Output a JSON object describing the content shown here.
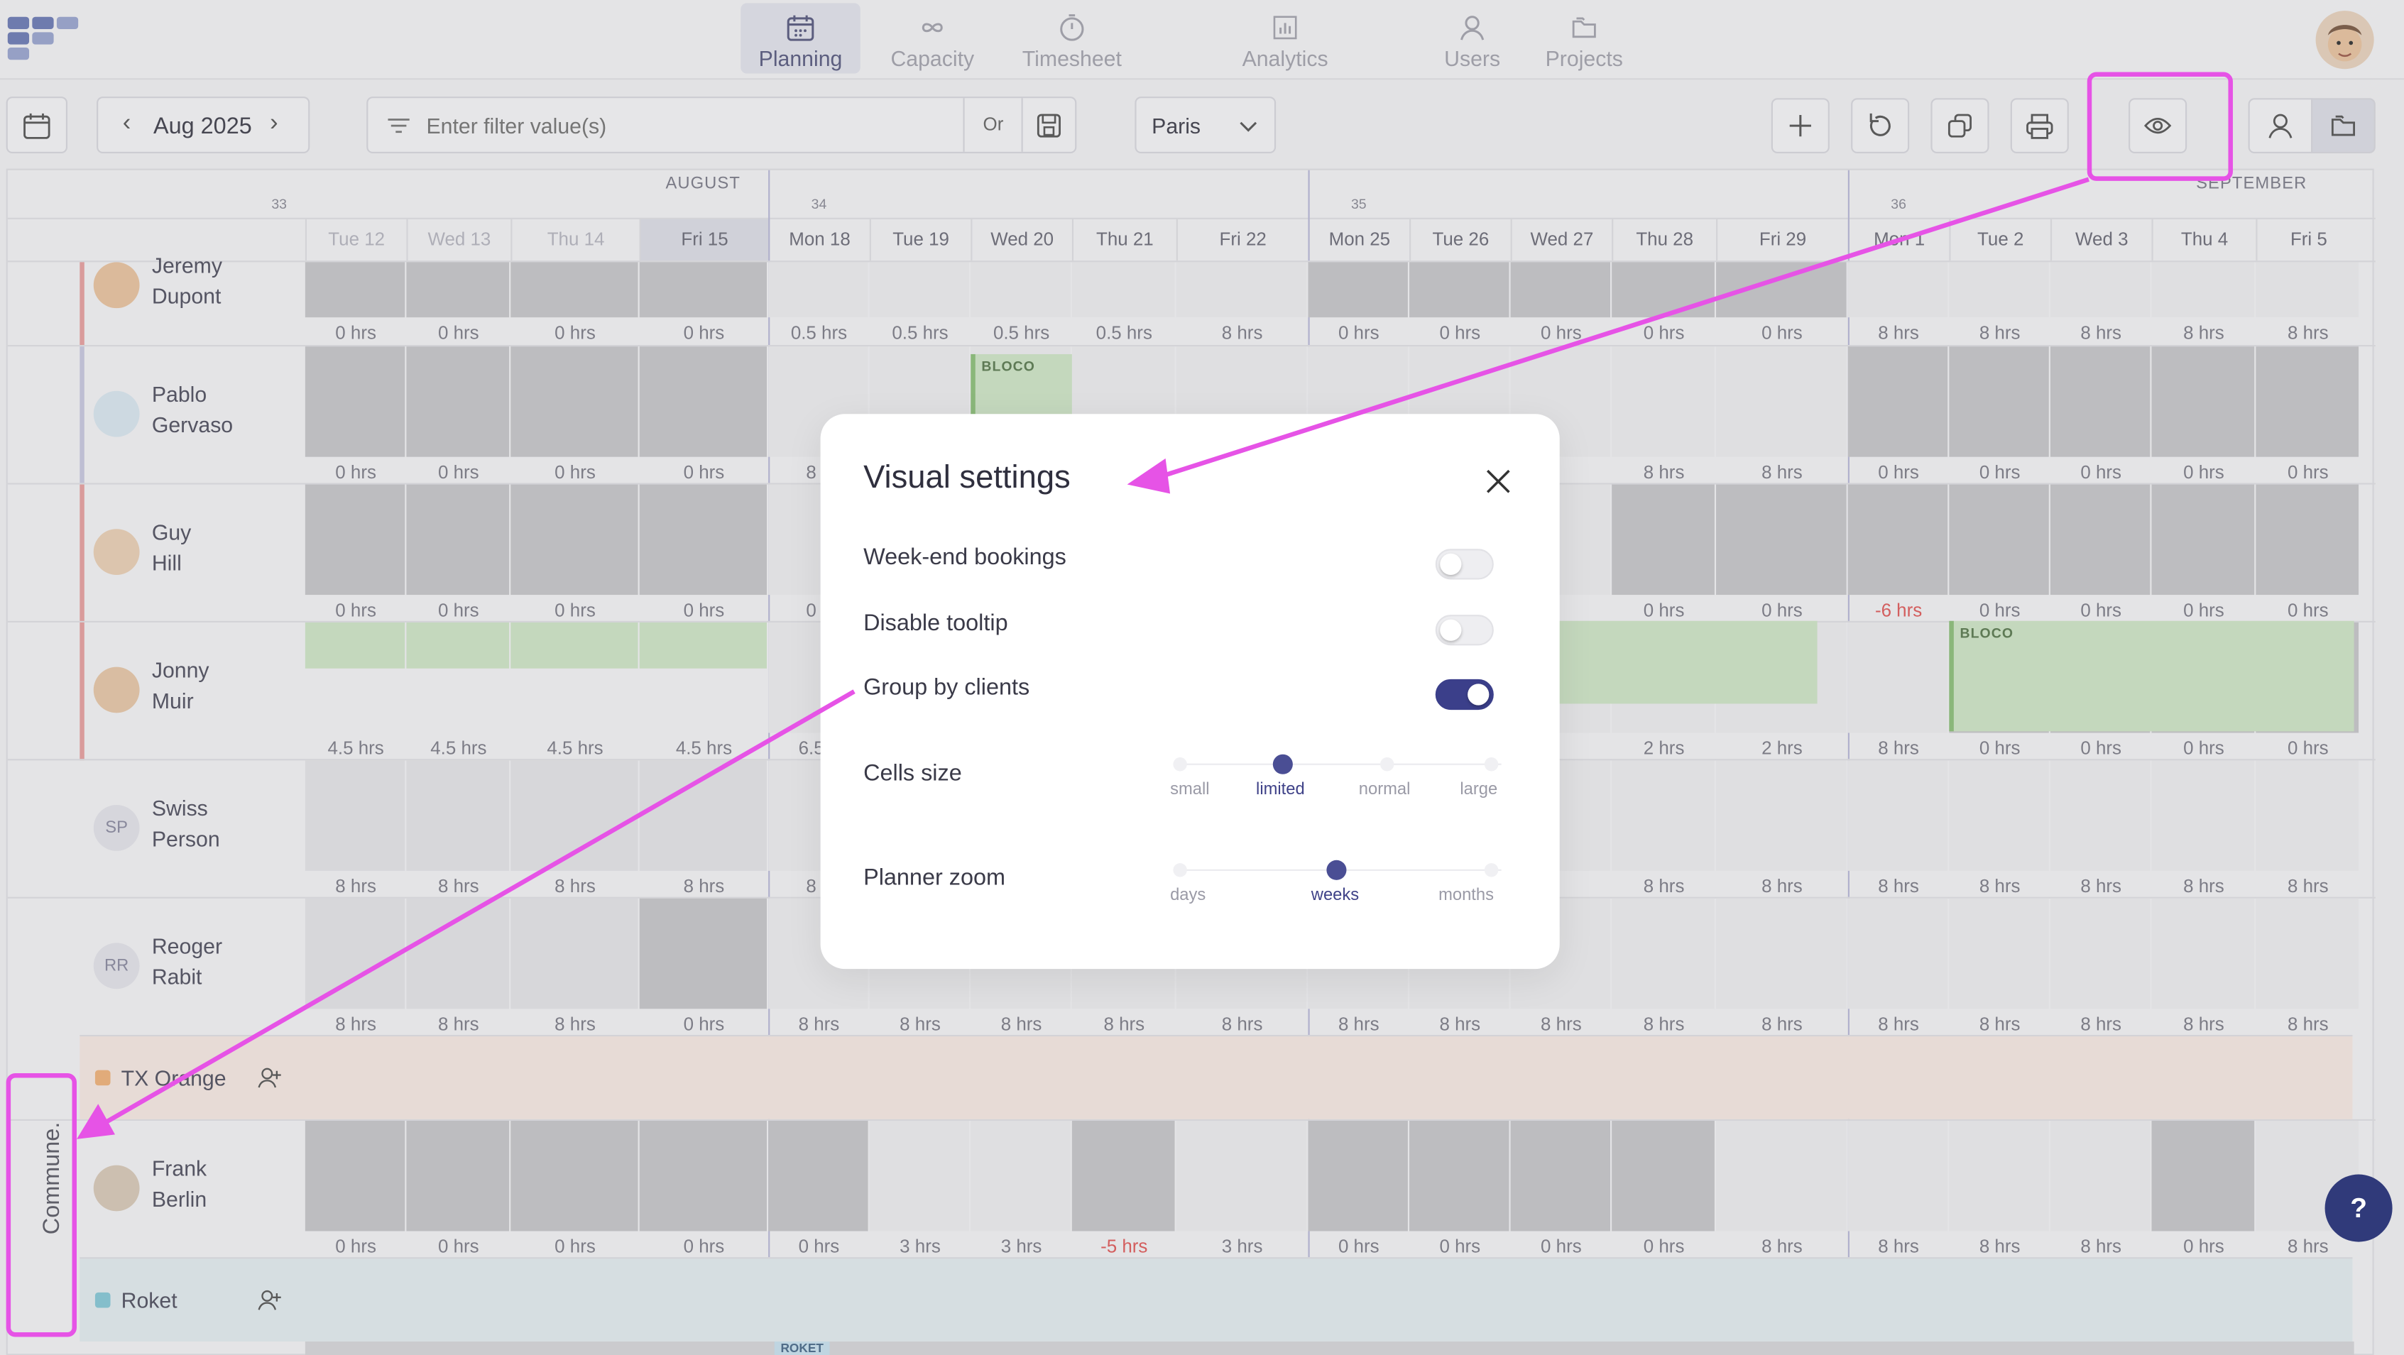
{
  "nav": [
    {
      "label": "Planning",
      "icon": "calendar-icon",
      "active": true
    },
    {
      "label": "Capacity",
      "icon": "infinity-icon"
    },
    {
      "label": "Timesheet",
      "icon": "stopwatch-icon"
    },
    {
      "label": "Analytics",
      "icon": "bar-chart-icon"
    },
    {
      "label": "Users",
      "icon": "user-icon"
    },
    {
      "label": "Projects",
      "icon": "folder-icon"
    }
  ],
  "toolbar": {
    "month": "Aug 2025",
    "filter_placeholder": "Enter filter value(s)",
    "or_label": "Or",
    "timezone": "Paris"
  },
  "timeline": {
    "months": [
      "AUGUST",
      "SEPTEMBER"
    ],
    "weeks": [
      "33",
      "34",
      "35",
      "36"
    ],
    "days": [
      "Tue 12",
      "Wed 13",
      "Thu 14",
      "Fri 15",
      "Mon 18",
      "Tue 19",
      "Wed 20",
      "Thu 21",
      "Fri 22",
      "Mon 25",
      "Tue 26",
      "Wed 27",
      "Thu 28",
      "Fri 29",
      "Mon 1",
      "Tue 2",
      "Wed 3",
      "Thu 4",
      "Fri 5"
    ]
  },
  "people": [
    {
      "first": "Jeremy",
      "last": "Dupont",
      "hours": [
        "0 hrs",
        "0 hrs",
        "0 hrs",
        "0 hrs",
        "0.5 hrs",
        "0.5 hrs",
        "0.5 hrs",
        "0.5 hrs",
        "8 hrs",
        "0 hrs",
        "0 hrs",
        "0 hrs",
        "0 hrs",
        "0 hrs",
        "8 hrs",
        "8 hrs",
        "8 hrs",
        "8 hrs",
        "8 hrs"
      ]
    },
    {
      "first": "Pablo",
      "last": "Gervaso",
      "hours": [
        "0 hrs",
        "0 hrs",
        "0 hrs",
        "0 hrs",
        "8 h",
        "",
        "",
        "",
        "",
        "",
        "",
        "",
        "8 hrs",
        "8 hrs",
        "0 hrs",
        "0 hrs",
        "0 hrs",
        "0 hrs",
        "0 hrs"
      ]
    },
    {
      "first": "Guy",
      "last": "Hill",
      "hours": [
        "0 hrs",
        "0 hrs",
        "0 hrs",
        "0 hrs",
        "0 h",
        "",
        "",
        "",
        "",
        "",
        "",
        "",
        "0 hrs",
        "0 hrs",
        "-6 hrs",
        "0 hrs",
        "0 hrs",
        "0 hrs",
        "0 hrs"
      ]
    },
    {
      "first": "Jonny",
      "last": "Muir",
      "hours": [
        "4.5 hrs",
        "4.5 hrs",
        "4.5 hrs",
        "4.5 hrs",
        "6.5 h",
        "",
        "",
        "",
        "",
        "",
        "",
        "",
        "2 hrs",
        "2 hrs",
        "8 hrs",
        "0 hrs",
        "0 hrs",
        "0 hrs",
        "0 hrs"
      ]
    },
    {
      "first": "Swiss",
      "last": "Person",
      "initials": "SP",
      "hours": [
        "8 hrs",
        "8 hrs",
        "8 hrs",
        "8 hrs",
        "8 h",
        "",
        "",
        "",
        "",
        "",
        "",
        "",
        "8 hrs",
        "8 hrs",
        "8 hrs",
        "8 hrs",
        "8 hrs",
        "8 hrs",
        "8 hrs"
      ]
    },
    {
      "first": "Reoger",
      "last": "Rabit",
      "initials": "RR",
      "hours": [
        "8 hrs",
        "8 hrs",
        "8 hrs",
        "0 hrs",
        "8 hrs",
        "8 hrs",
        "8 hrs",
        "8 hrs",
        "8 hrs",
        "8 hrs",
        "8 hrs",
        "8 hrs",
        "8 hrs",
        "8 hrs",
        "8 hrs",
        "8 hrs",
        "8 hrs",
        "8 hrs",
        "8 hrs"
      ]
    },
    {
      "first": "Frank",
      "last": "Berlin",
      "hours": [
        "0 hrs",
        "0 hrs",
        "0 hrs",
        "0 hrs",
        "0 hrs",
        "3 hrs",
        "3 hrs",
        "-5 hrs",
        "3 hrs",
        "0 hrs",
        "0 hrs",
        "0 hrs",
        "0 hrs",
        "8 hrs",
        "8 hrs",
        "8 hrs",
        "8 hrs",
        "0 hrs",
        "8 hrs"
      ]
    }
  ],
  "groups": [
    {
      "name": "TX Orange",
      "color": "#f0b27a"
    },
    {
      "name": "Roket",
      "color": "#86c8d6"
    }
  ],
  "booking_label": "BLOCO",
  "booking_label_roket": "ROKET",
  "side_label": "Commune.",
  "modal": {
    "title": "Visual settings",
    "weekend_label": "Week-end bookings",
    "weekend_on": false,
    "tooltip_label": "Disable tooltip",
    "tooltip_on": false,
    "group_label": "Group by clients",
    "group_on": true,
    "cells_label": "Cells size",
    "cells_options": [
      "small",
      "limited",
      "normal",
      "large"
    ],
    "cells_selected": "limited",
    "zoom_label": "Planner zoom",
    "zoom_options": [
      "days",
      "weeks",
      "months"
    ],
    "zoom_selected": "weeks"
  },
  "help_label": "?",
  "colors": {
    "accent": "#3b3f8a",
    "highlight": "#e653e6",
    "booking": "#cfe5c6",
    "negative": "#e05a5a"
  }
}
